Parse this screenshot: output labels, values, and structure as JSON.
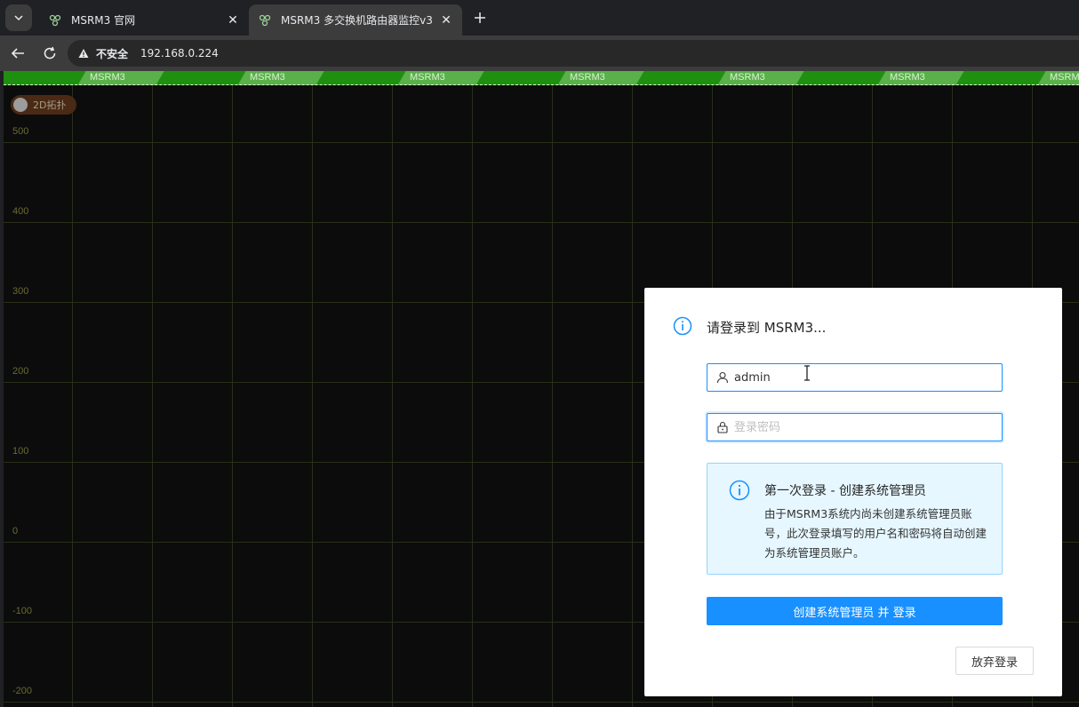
{
  "browser": {
    "tabs": [
      {
        "title": "MSRM3 官网",
        "active": false
      },
      {
        "title": "MSRM3 多交换机路由器监控v3",
        "active": true
      }
    ],
    "security_label": "不安全",
    "url": "192.168.0.224"
  },
  "banner": {
    "text": "MSRM3",
    "colors": [
      "#5ab04a",
      "#1f8f10"
    ]
  },
  "page": {
    "toggle_label": "2D拓扑",
    "y_axis_labels": [
      "500",
      "400",
      "300",
      "200",
      "100",
      "0",
      "-100",
      "-200"
    ],
    "grid_color": "#27301a"
  },
  "login_modal": {
    "title": "请登录到 MSRM3...",
    "username_value": "admin",
    "password_placeholder": "登录密码",
    "alert_title": "第一次登录 - 创建系统管理员",
    "alert_description": "由于MSRM3系统内尚未创建系统管理员账号，此次登录填写的用户名和密码将自动创建为系统管理员账户。",
    "primary_button": "创建系统管理员 并 登录",
    "cancel_button": "放弃登录",
    "accent_color": "#1890ff"
  }
}
